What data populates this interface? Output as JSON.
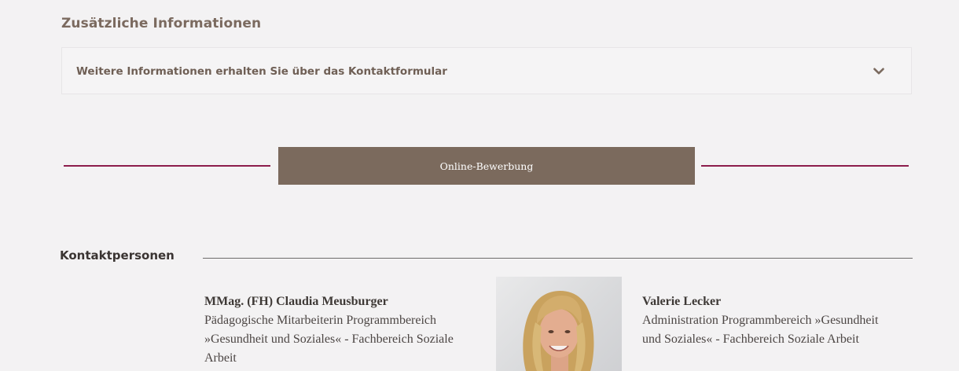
{
  "info_section": {
    "title": "Zusätzliche Informationen",
    "accordion_label": "Weitere Informationen erhalten Sie über das Kontaktformular",
    "accordion_icon": "chevron-down-icon"
  },
  "apply": {
    "button_label": "Online-Bewerbung",
    "line_color": "#8c1d4c",
    "button_color": "#7b6a5d"
  },
  "contacts": {
    "heading": "Kontaktpersonen",
    "people": [
      {
        "name": "MMag. (FH) Claudia Meusburger",
        "role": "Pädagogische Mitarbeiterin Programmbereich »Gesundheit und Soziales« - Fachbereich Soziale Arbeit"
      },
      {
        "name": "Valerie Lecker",
        "role": "Administration Programmbereich »Gesundheit und Soziales« - Fachbereich Soziale Arbeit"
      }
    ]
  }
}
